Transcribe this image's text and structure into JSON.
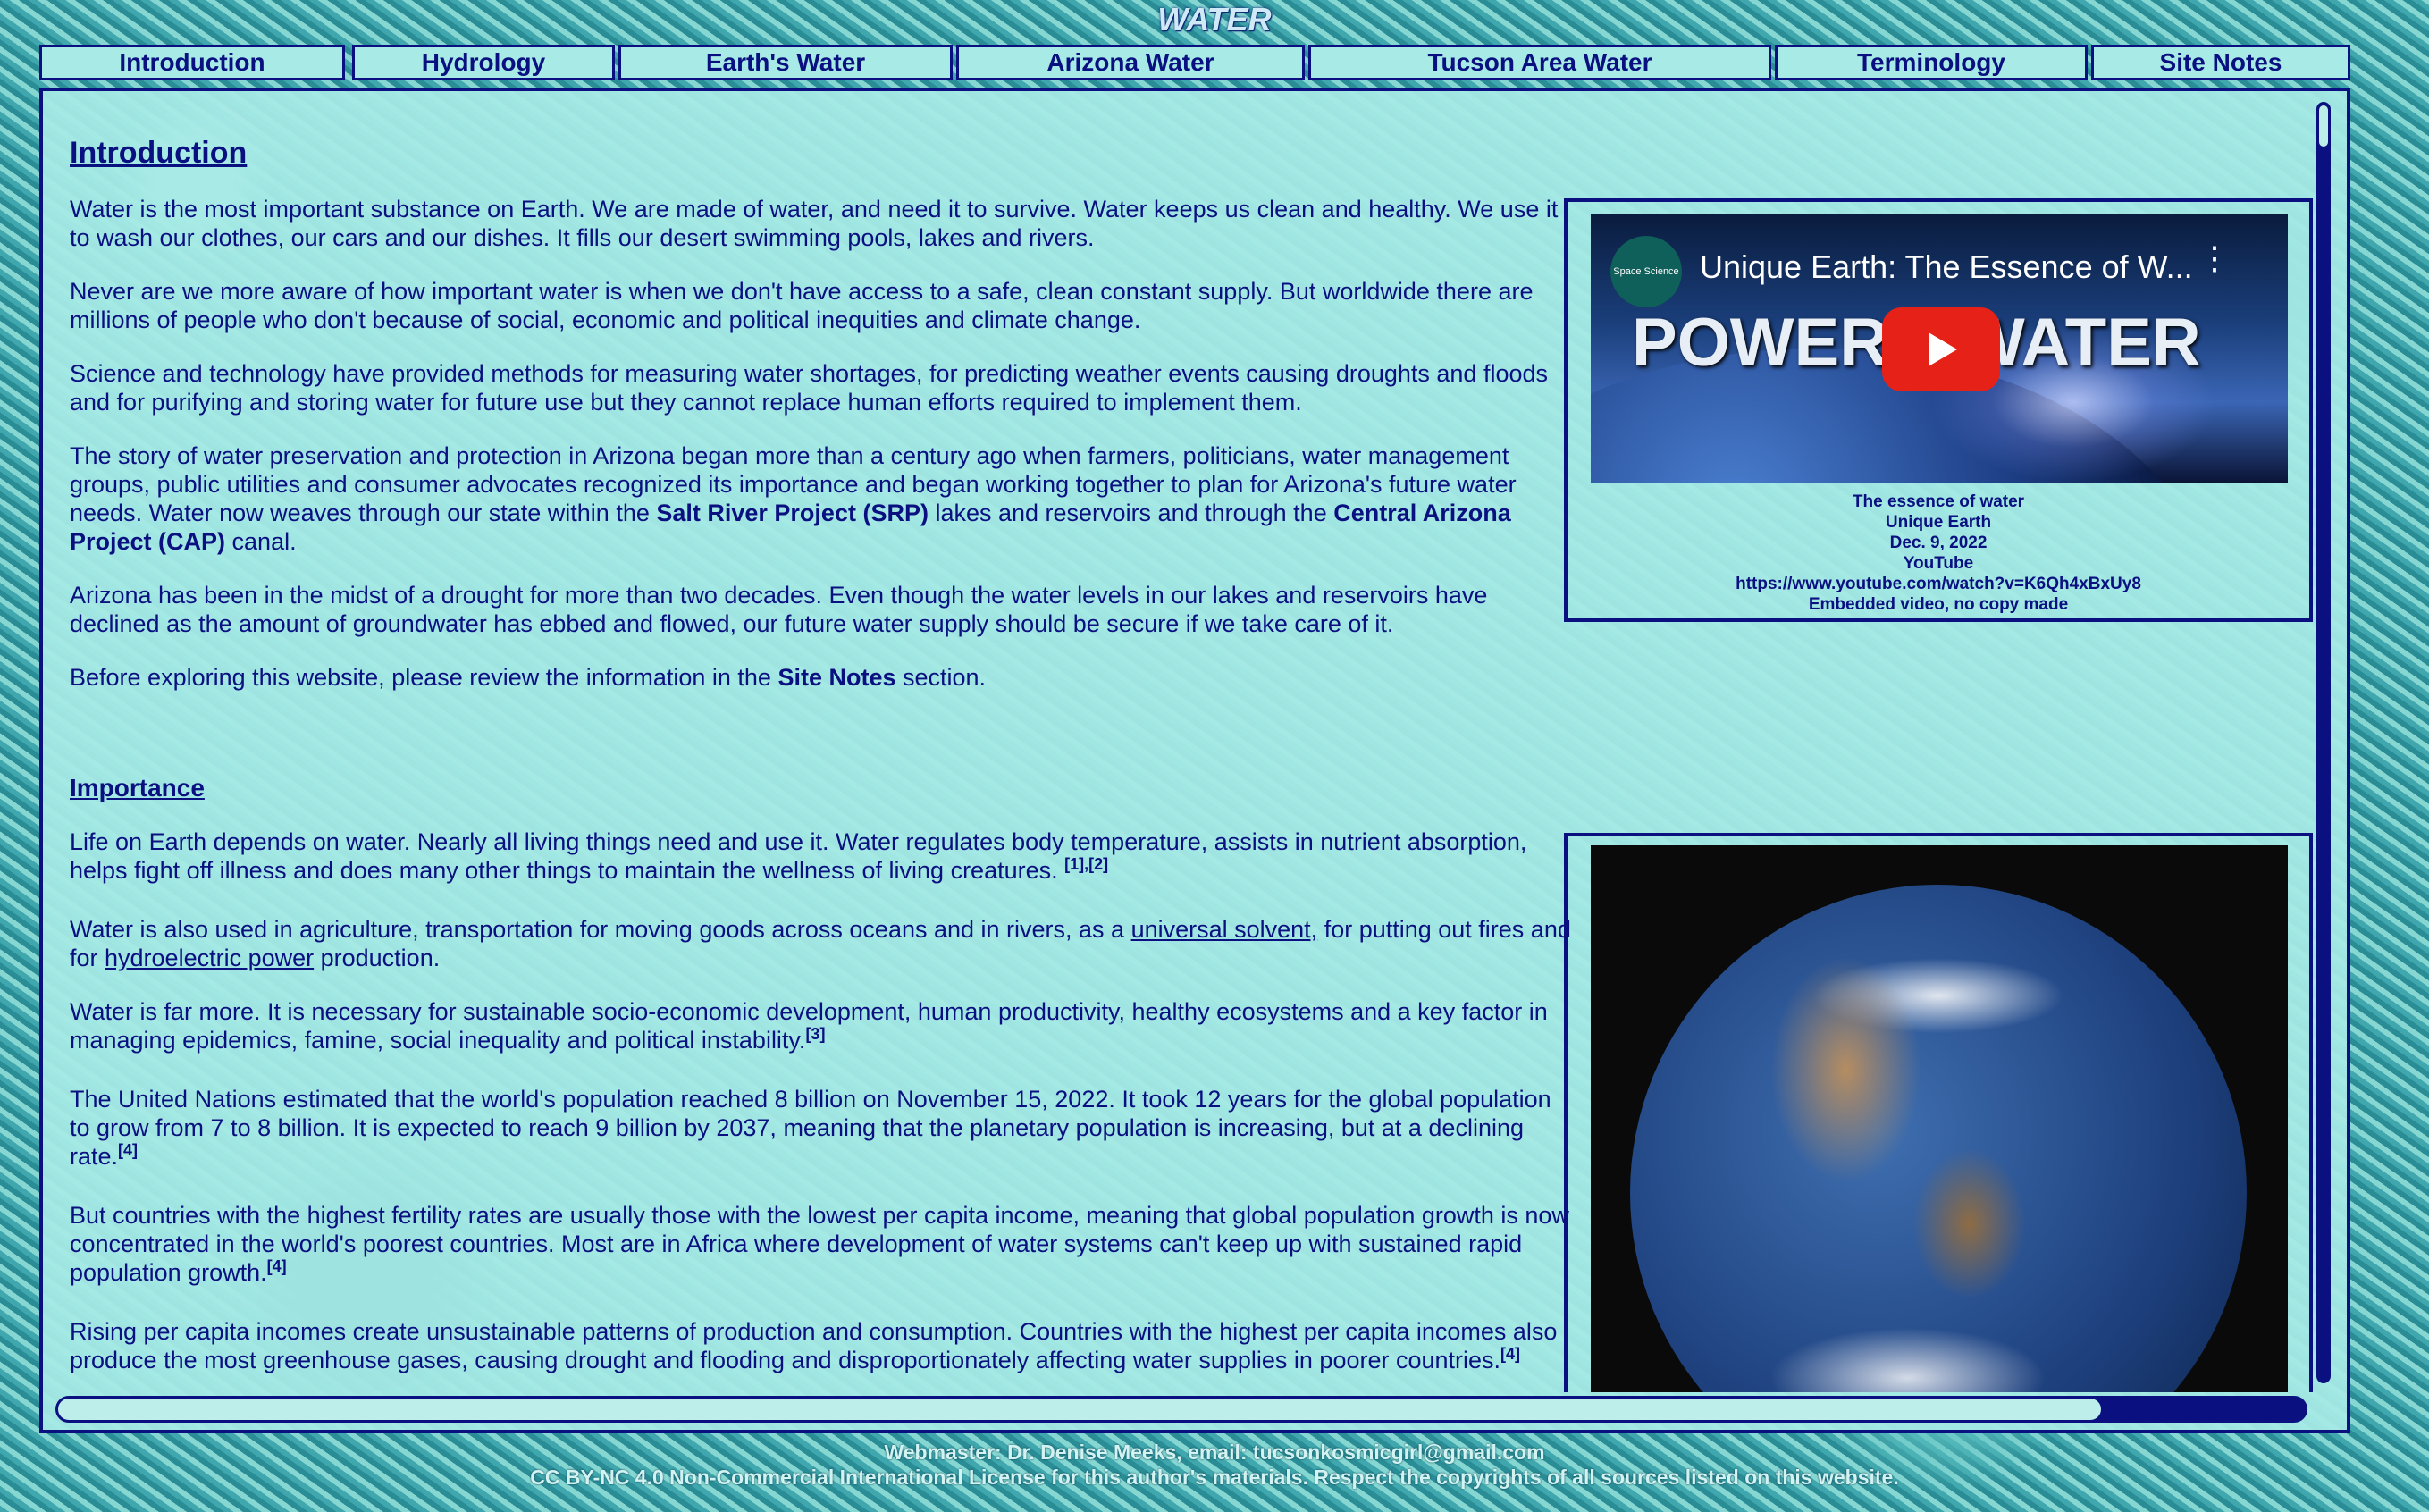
{
  "site": {
    "title": "WATER"
  },
  "nav": {
    "items": [
      {
        "label": "Introduction"
      },
      {
        "label": "Hydrology"
      },
      {
        "label": "Earth's Water"
      },
      {
        "label": "Arizona Water"
      },
      {
        "label": "Tucson Area Water"
      },
      {
        "label": "Terminology"
      },
      {
        "label": "Site Notes"
      }
    ]
  },
  "intro": {
    "heading": "Introduction",
    "p1": "Water is the most important substance on Earth. We are made of water, and need it to survive. Water keeps us clean and healthy. We use it to wash our clothes, our cars and our dishes. It fills our desert swimming pools, lakes and rivers.",
    "p2": "Never are we more aware of how important water is when we don't have access to a safe, clean constant supply. But worldwide there are millions of people who don't because of social, economic and political inequities and climate change.",
    "p3": "Science and technology have provided methods for measuring water shortages, for predicting weather events causing droughts and floods and for purifying and storing water for future use but they cannot replace human efforts required to implement them.",
    "p4_a": "The story of water preservation and protection in Arizona began more than a century ago when farmers, politicians, water management groups, public utilities and consumer advocates recognized its importance and began working together to plan for Arizona's future water needs. Water now weaves through our state within the ",
    "p4_srp": "Salt River Project (SRP)",
    "p4_b": " lakes and reservoirs and through the ",
    "p4_cap": "Central Arizona Project (CAP)",
    "p4_c": " canal.",
    "p5": "Arizona has been in the midst of a drought for more than two decades. Even though the water levels in our lakes and reservoirs have declined as the amount of groundwater has ebbed and flowed, our future water supply should be secure if we take care of it.",
    "p6_a": "Before exploring this website, please review the information in the ",
    "p6_link": "Site Notes",
    "p6_b": " section."
  },
  "video": {
    "channel": "Space Science",
    "title": "Unique Earth: The Essence of W...",
    "word_left": "POWER",
    "word_right": "WATER",
    "caption": [
      "The essence of water",
      "Unique Earth",
      "Dec. 9, 2022",
      "YouTube",
      "https://www.youtube.com/watch?v=K6Qh4xBxUy8",
      "Embedded video, no copy made"
    ]
  },
  "importance": {
    "heading": "Importance",
    "p1": "Life on Earth depends on water. Nearly all living things need and use it. Water regulates body temperature, assists in nutrient absorption, helps fight off illness and does many other things to maintain the wellness of living creatures. ",
    "p1_ref": "[1],[2]",
    "p2_a": "Water is also used in agriculture, transportation for moving goods across oceans and in rivers, as a ",
    "p2_link1": "universal solvent,",
    "p2_b": " for putting out fires and for ",
    "p2_link2": "hydroelectric power",
    "p2_c": " production.",
    "p3": "Water is far more. It is necessary for sustainable socio-economic development, human productivity, healthy ecosystems and a key factor in managing epidemics, famine, social inequality and political instability.",
    "p3_ref": "[3]",
    "p4": "The United Nations estimated that the world's population reached 8 billion on November 15, 2022. It took 12 years for the global population to grow from 7 to 8 billion. It is expected to reach 9 billion by 2037, meaning that the planetary population is increasing, but at a declining rate.",
    "p4_ref": "[4]",
    "p5": "But countries with the highest fertility rates are usually those with the lowest per capita income, meaning that global population growth is now concentrated in the world's poorest countries. Most are in Africa where development of water systems can't keep up with sustained rapid population growth.",
    "p5_ref": "[4]",
    "p6": "Rising per capita incomes create unsustainable patterns of production and consumption. Countries with the highest per capita incomes also produce the most greenhouse gases, causing drought and flooding and disproportionately affecting water supplies in poorer countries.",
    "p6_ref": "[4]"
  },
  "footer": {
    "line1": "Webmaster: Dr. Denise Meeks, email: tucsonkosmicgirl@gmail.com",
    "line2": "CC BY-NC 4.0 Non-Commercial International License for this author's materials. Respect the copyrights of all sources listed on this website."
  },
  "colors": {
    "accent": "#0a1080",
    "panel": "#a8ebe6",
    "video_play": "#e62117"
  }
}
